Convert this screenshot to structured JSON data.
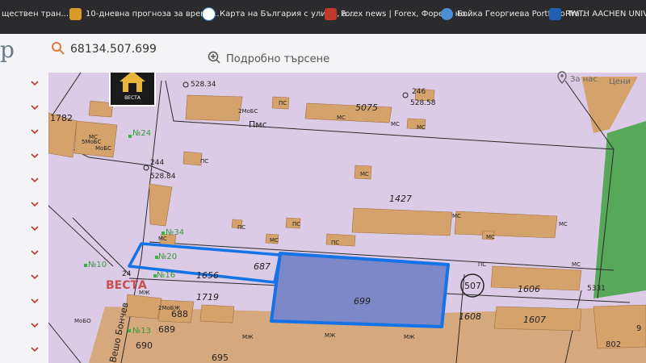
{
  "bookmarks": [
    {
      "label": "ществен тран...",
      "icon": "transport-icon",
      "color": "#5a5a5a"
    },
    {
      "label": "10-дневна прогноза за време...",
      "icon": "weather-s-icon",
      "color": "#d89a2a"
    },
    {
      "label": "Карта на България с улици, а...",
      "icon": "bg-map-icon",
      "color": "#3a7bd5"
    },
    {
      "label": "Forex news | Forex, Форекс но...",
      "icon": "forex-icon",
      "color": "#c0392b"
    },
    {
      "label": "Бойка Георгиева Portfolio Tra...",
      "icon": "portfolio-icon",
      "color": "#4a8fd8"
    },
    {
      "label": "RWTH AACHEN UNIVERSITY ...",
      "icon": "rwth-icon",
      "color": "#2060b0"
    }
  ],
  "header": {
    "logo_fragment": "p",
    "search_value": "68134.507.699",
    "advanced_search": "Подробно търсене",
    "about": "За нас",
    "prices": "Цени"
  },
  "map": {
    "watermark_logo_text": "ВЕСТА",
    "watermark_text": "ВЕСТА",
    "parcels": {
      "p1782": "1782",
      "p5075": "5075",
      "p1427": "1427",
      "p1656": "1656",
      "p687": "687",
      "p699": "699",
      "p1606": "1606",
      "p1608": "1608",
      "p1607": "1607",
      "p1719": "1719",
      "p688": "688",
      "p689": "689",
      "p690": "690",
      "p695": "695",
      "p507": "507",
      "p5331": "5331",
      "p802": "802",
      "p9": "9"
    },
    "points": {
      "pt52834": "528.34",
      "pt244": "244",
      "pt52884": "528.84",
      "pt246": "246",
      "pt52858": "528.58",
      "pt24": "24"
    },
    "buildings": {
      "pms": "Пмс",
      "ms": "МС",
      "ps": "ПС",
      "mzh": "МЖ",
      "mos": "2МоБС",
      "mobs5": "5МоБС",
      "mobs": "МоБС",
      "mobo": "МоБО",
      "mobzh": "2МоБЖ"
    },
    "addresses": {
      "no24": "№24",
      "no34": "№34",
      "no20": "№20",
      "no16": "№16",
      "no10": "№10",
      "no13": "№13"
    },
    "street": "Вешо Бончев",
    "colors": {
      "map_bg": "#dccbe6",
      "building": "#d4a26a",
      "highlight_fill": "#7d88c8",
      "highlight_stroke": "#1473e6",
      "green": "#58a85a"
    }
  }
}
